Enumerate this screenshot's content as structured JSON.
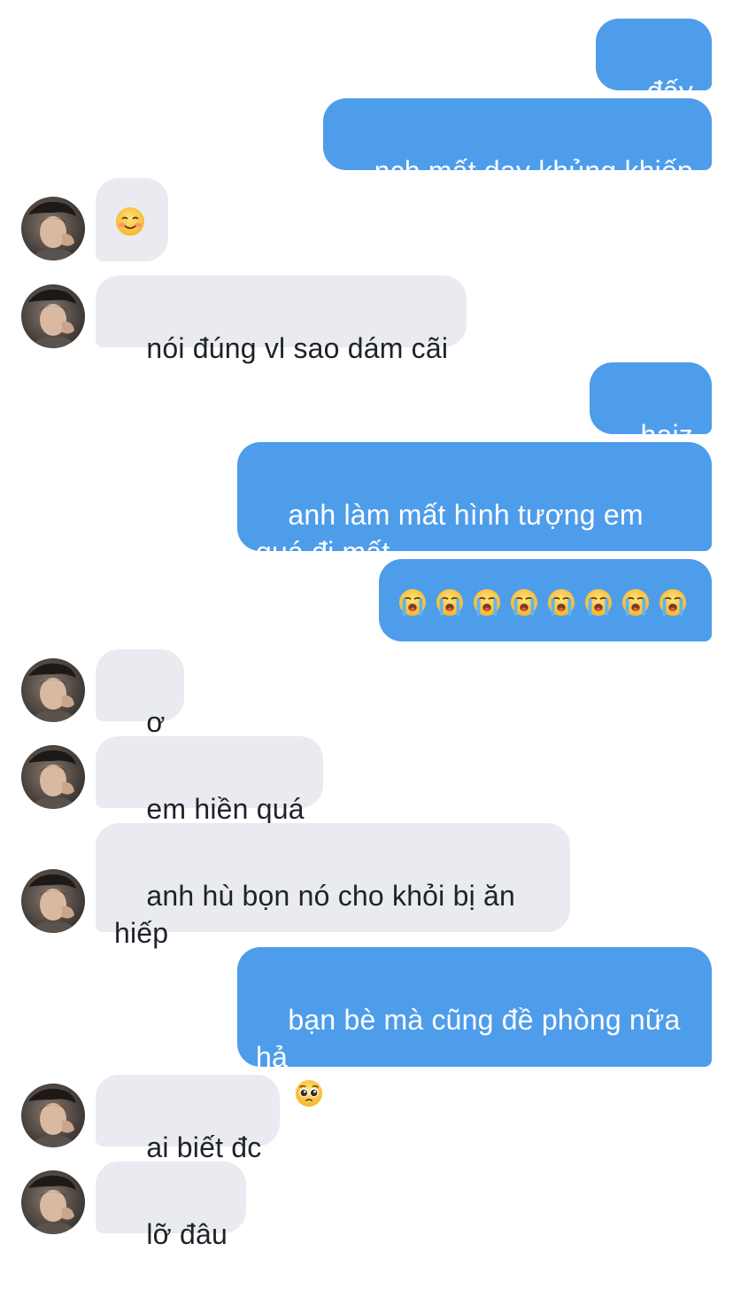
{
  "messages": [
    {
      "side": "out",
      "text": "đấy"
    },
    {
      "side": "out",
      "text": "nch mất dạy khủng khiếp"
    },
    {
      "side": "in",
      "emoji": "smiling-face-blush",
      "text": ""
    },
    {
      "side": "in",
      "text": "nói đúng vl sao dám cãi"
    },
    {
      "side": "out",
      "text": "haiz"
    },
    {
      "side": "out",
      "text": "anh làm mất hình tượng em\nquá đi mất"
    },
    {
      "side": "out",
      "emoji": "loudly-crying-face",
      "emoji_count": 8,
      "text": ""
    },
    {
      "side": "in",
      "text": "ơ"
    },
    {
      "side": "in",
      "text": "em hiền quá"
    },
    {
      "side": "in",
      "text": "anh hù bọn nó cho khỏi bị ăn\nhiếp"
    },
    {
      "side": "out",
      "text": "bạn bè mà cũng đề phòng nữa\nhả",
      "trailing_emoji": "pleading-face"
    },
    {
      "side": "in",
      "text": "ai biết đc"
    },
    {
      "side": "in",
      "text": "lỡ đâu"
    }
  ],
  "colors": {
    "outgoing_bubble": "#4e9deb",
    "incoming_bubble": "#e9ebf0",
    "outgoing_text": "#ffffff",
    "incoming_text": "#1f2328"
  }
}
